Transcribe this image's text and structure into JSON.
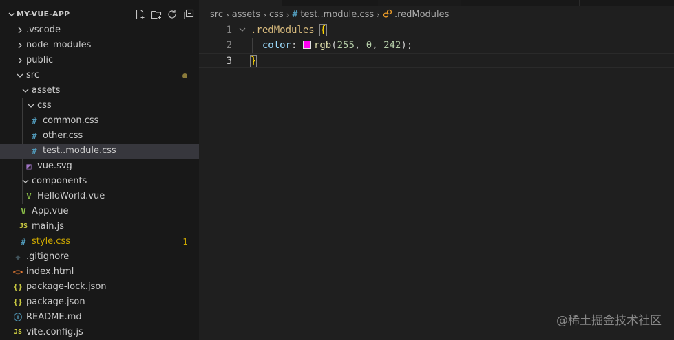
{
  "explorer": {
    "project_title": "MY-VUE-APP",
    "actions": [
      "new-file-icon",
      "new-folder-icon",
      "refresh-icon",
      "collapse-all-icon"
    ],
    "tree": [
      {
        "label": ".vscode",
        "type": "folder",
        "expanded": false,
        "depth": 0
      },
      {
        "label": "node_modules",
        "type": "folder",
        "expanded": false,
        "depth": 0
      },
      {
        "label": "public",
        "type": "folder",
        "expanded": false,
        "depth": 0
      },
      {
        "label": "src",
        "type": "folder",
        "expanded": true,
        "depth": 0,
        "modified": true
      },
      {
        "label": "assets",
        "type": "folder",
        "expanded": true,
        "depth": 1
      },
      {
        "label": "css",
        "type": "folder",
        "expanded": true,
        "depth": 2
      },
      {
        "label": "common.css",
        "type": "css",
        "depth": 3
      },
      {
        "label": "other.css",
        "type": "css",
        "depth": 3
      },
      {
        "label": "test..module.css",
        "type": "css",
        "depth": 3,
        "selected": true
      },
      {
        "label": "vue.svg",
        "type": "svg",
        "depth": 2
      },
      {
        "label": "components",
        "type": "folder",
        "expanded": true,
        "depth": 1
      },
      {
        "label": "HelloWorld.vue",
        "type": "vue",
        "depth": 2
      },
      {
        "label": "App.vue",
        "type": "vue",
        "depth": 1
      },
      {
        "label": "main.js",
        "type": "js",
        "depth": 1
      },
      {
        "label": "style.css",
        "type": "css",
        "depth": 1,
        "badge": "1",
        "warning": true
      },
      {
        "label": ".gitignore",
        "type": "git",
        "depth": 0
      },
      {
        "label": "index.html",
        "type": "html",
        "depth": 0
      },
      {
        "label": "package-lock.json",
        "type": "json",
        "depth": 0
      },
      {
        "label": "package.json",
        "type": "json",
        "depth": 0
      },
      {
        "label": "README.md",
        "type": "info",
        "depth": 0
      },
      {
        "label": "vite.config.js",
        "type": "js",
        "depth": 0
      }
    ]
  },
  "breadcrumbs": {
    "items": [
      "src",
      "assets",
      "css",
      "test..module.css",
      ".redModules"
    ]
  },
  "code": {
    "line_numbers": [
      "1",
      "2",
      "3"
    ],
    "selector": ".redModules",
    "open_brace": "{",
    "property": "color",
    "colon": ":",
    "fn_name": "rgb",
    "fn_args_open": "(",
    "r": "255",
    "g": "0",
    "b": "242",
    "comma1": ", ",
    "comma2": ", ",
    "fn_args_close": ")",
    "semicolon": ";",
    "close_brace": "}",
    "swatch_color": "#ff00f2"
  },
  "icon_glyphs": {
    "css": "#",
    "js": "JS",
    "json": "{}",
    "html": "<>",
    "vue": "V",
    "git": "◆",
    "info": "ⓘ",
    "svg": "◩"
  },
  "colors": {
    "css": "#519aba",
    "js": "#cbcb41",
    "json": "#cbcb41",
    "html": "#e37933",
    "vue": "#8dc149",
    "git": "#41535b",
    "info": "#519aba",
    "svg": "#a074c4",
    "warning": "#cca700"
  },
  "watermark": "@稀土掘金技术社区"
}
